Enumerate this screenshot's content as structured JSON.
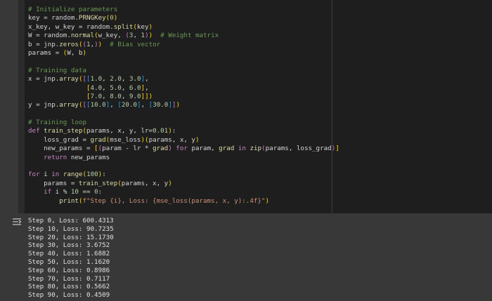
{
  "code_cell": {
    "lines": [
      "# Initialize parameters",
      "key = random.PRNGKey(0)",
      "x_key, w_key = random.split(key)",
      "W = random.normal(w_key, (3, 1))  # Weight matrix",
      "b = jnp.zeros((1,))  # Bias vector",
      "params = (W, b)",
      "",
      "# Training data",
      "x = jnp.array([[1.0, 2.0, 3.0],",
      "               [4.0, 5.0, 6.0],",
      "               [7.0, 8.0, 9.0]])",
      "y = jnp.array([[10.0], [20.0], [30.0]])",
      "",
      "# Training loop",
      "def train_step(params, x, y, lr=0.01):",
      "    loss_grad = grad(mse_loss)(params, x, y)",
      "    new_params = [(param - lr * grad) for param, grad in zip(params, loss_grad)]",
      "    return new_params",
      "",
      "for i in range(100):",
      "    params = train_step(params, x, y)",
      "    if i % 10 == 0:",
      "        print(f\"Step {i}, Loss: {mse_loss(params, x, y):.4f}\")"
    ]
  },
  "output": {
    "icon": "output-toggle-icon",
    "lines": [
      "Step 0, Loss: 600.4313",
      "Step 10, Loss: 90.7235",
      "Step 20, Loss: 15.1730",
      "Step 30, Loss: 3.6752",
      "Step 40, Loss: 1.6882",
      "Step 50, Loss: 1.1620",
      "Step 60, Loss: 0.8986",
      "Step 70, Loss: 0.7117",
      "Step 80, Loss: 0.5662",
      "Step 90, Loss: 0.4509"
    ]
  },
  "colors": {
    "editor_bg": "#1e1e1e",
    "output_bg": "#383838",
    "comment": "#6a9955",
    "keyword": "#c586c0",
    "function": "#dcdcaa",
    "number": "#b5cea8",
    "string": "#ce9178"
  }
}
